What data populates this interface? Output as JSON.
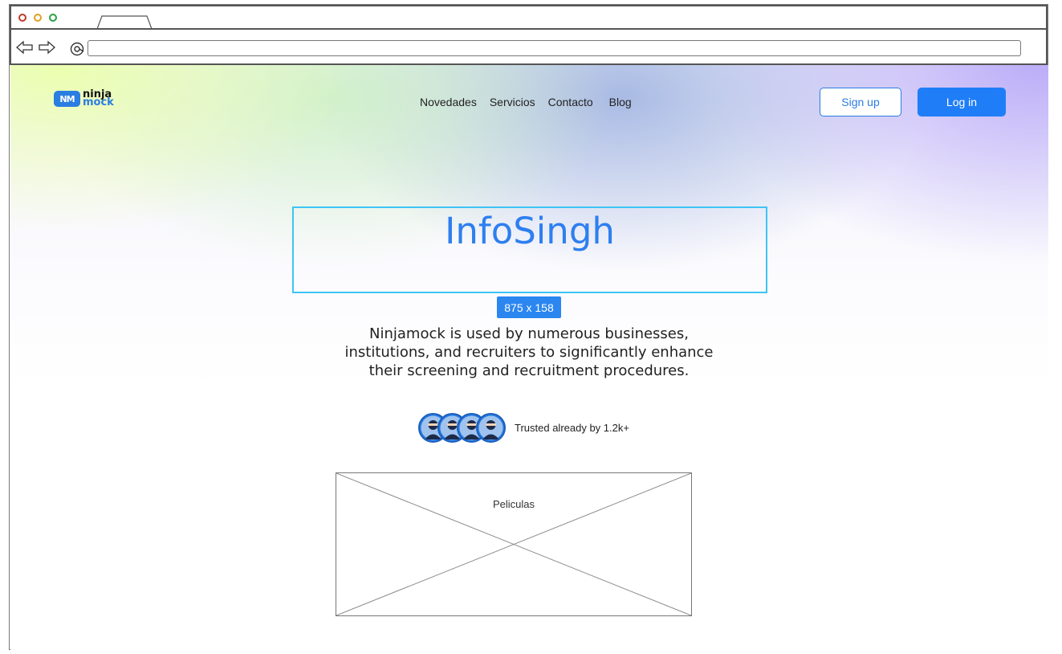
{
  "browser": {
    "window_dots": [
      "close",
      "minimize",
      "maximize"
    ],
    "colors": {
      "close": "#c0392b",
      "minimize": "#e0a020",
      "maximize": "#27a243"
    },
    "url": ""
  },
  "header": {
    "logo": {
      "badge": "NM",
      "line1": "ninja",
      "line2": "mock",
      "brand_color": "#2a7de1"
    },
    "nav": [
      "Novedades",
      "Servicios",
      "Contacto",
      "Blog"
    ],
    "signup_label": "Sign up",
    "login_label": "Log in"
  },
  "hero": {
    "title": "InfoSingh",
    "dimension_badge": "875 x 158",
    "subtitle_lines": [
      "Ninjamock is used by numerous businesses,",
      "institutions, and recruiters to significantly enhance",
      "their screening and recruitment procedures."
    ],
    "trusted_text": "Trusted already by 1.2k+",
    "avatar_count": 4,
    "image_label": "Peliculas"
  },
  "icons": [
    "back-arrow-icon",
    "forward-arrow-icon",
    "refresh-icon",
    "avatar-icon",
    "image-placeholder-icon"
  ]
}
